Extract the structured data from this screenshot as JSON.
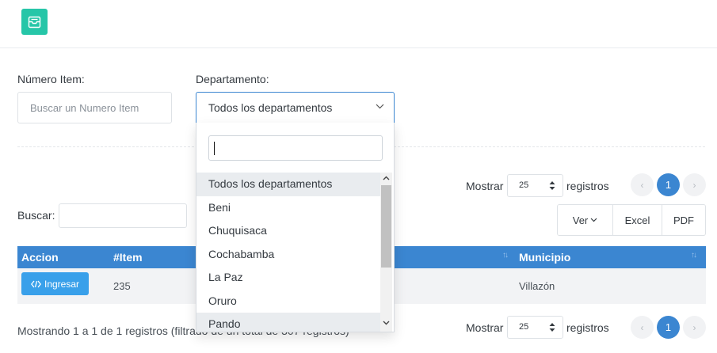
{
  "filters": {
    "numero_item_label": "Número Item:",
    "numero_item_placeholder": "Buscar un Numero Item",
    "departamento_label": "Departamento:",
    "departamento_selected": "Todos los departamentos"
  },
  "dropdown": {
    "search_value": "",
    "options": [
      "Todos los departamentos",
      "Beni",
      "Chuquisaca",
      "Cochabamba",
      "La Paz",
      "Oruro",
      "Pando"
    ],
    "highlighted": "Todos los departamentos"
  },
  "length_top": {
    "prefix": "Mostrar",
    "value": "25",
    "suffix": "registros"
  },
  "length_bottom": {
    "prefix": "Mostrar",
    "value": "25",
    "suffix": "registros"
  },
  "pagination": {
    "prev": "‹",
    "current": "1",
    "next": "›"
  },
  "search": {
    "label": "Buscar:",
    "value": ""
  },
  "export_buttons": {
    "ver": "Ver",
    "excel": "Excel",
    "pdf": "PDF"
  },
  "table": {
    "columns": [
      "Accion",
      "#Item",
      "Municipio"
    ],
    "rows": [
      {
        "action": "Ingresar",
        "item": "235",
        "municipio": "Villazón"
      }
    ]
  },
  "info": "Mostrando 1 a 1 de 1 registros (filtrado de un total de 307 registros)",
  "colors": {
    "primary": "#3b86d1",
    "accent": "#26c6a8",
    "button": "#39a0ea"
  }
}
